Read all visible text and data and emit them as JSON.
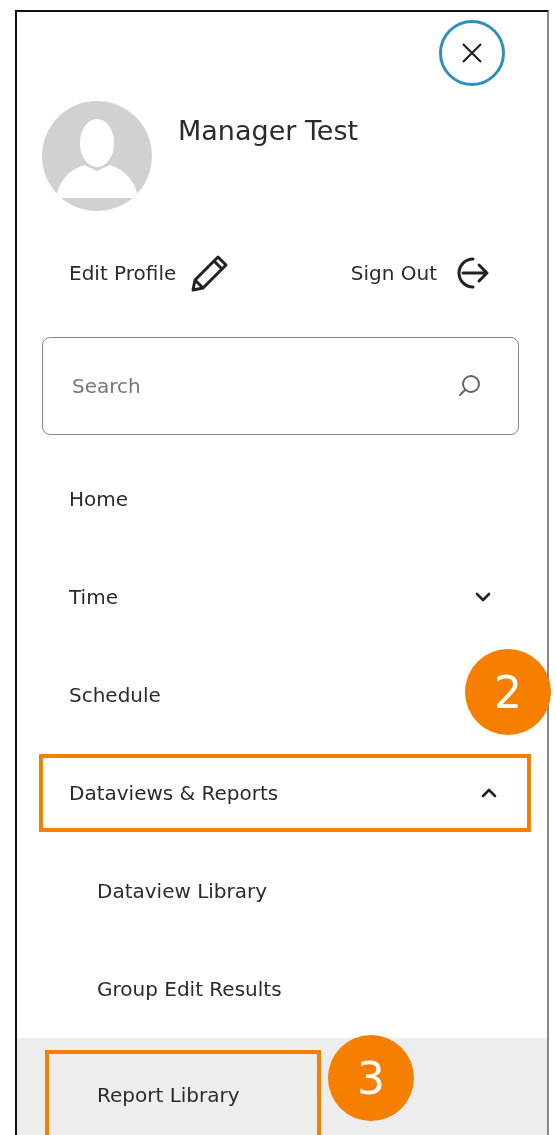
{
  "profile": {
    "name": "Manager Test"
  },
  "actions": [
    {
      "label": "Edit Profile",
      "kind": "edit"
    },
    {
      "label": "Sign Out",
      "kind": "signout"
    }
  ],
  "search": {
    "placeholder": "Search"
  },
  "menu": [
    {
      "label": "Home",
      "kind": "link"
    },
    {
      "label": "Time",
      "kind": "group",
      "expanded": false
    },
    {
      "label": "Schedule",
      "kind": "group"
    },
    {
      "label": "Dataviews & Reports",
      "kind": "group",
      "expanded": true,
      "highlighted": true,
      "callout": "2",
      "children": [
        {
          "label": "Dataview Library",
          "selected": false,
          "highlighted": false
        },
        {
          "label": "Group Edit Results",
          "selected": false,
          "highlighted": false
        },
        {
          "label": "Report Library",
          "selected": true,
          "highlighted": true,
          "callout": "3"
        }
      ]
    }
  ]
}
